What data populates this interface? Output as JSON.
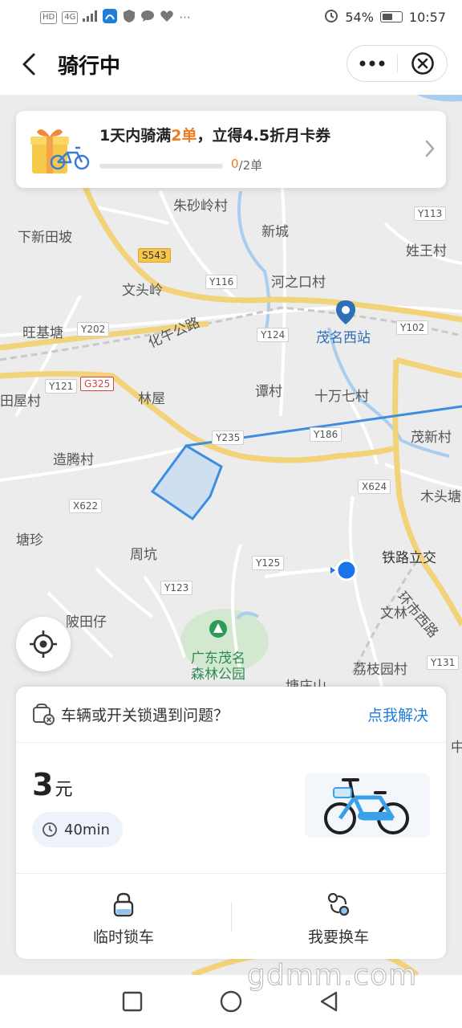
{
  "status_bar": {
    "chips": [
      "HD",
      "4G"
    ],
    "battery_percent": "54%",
    "battery_level": 0.54,
    "time": "10:57",
    "icons": [
      "signal-icon",
      "app-icon",
      "shield-icon",
      "chat-icon",
      "heart-icon",
      "more-icon",
      "alarm-icon",
      "battery-icon"
    ],
    "overflow": "···"
  },
  "header": {
    "title": "骑行中"
  },
  "promo": {
    "title_prefix": "1天内骑满",
    "title_highlight": "2单",
    "title_suffix": "，立得4.5折月卡券",
    "progress_current": "0",
    "progress_total": "/2单",
    "progress_fraction": 0
  },
  "map": {
    "labels": [
      "朱砂岭村",
      "新城",
      "下新田坡",
      "姓王村",
      "文头岭",
      "河之口村",
      "旺基塘",
      "化午公路",
      "茂名西站",
      "林屋",
      "谭村",
      "十万七村",
      "茂新村",
      "造腾村",
      "木头塘",
      "塘珍",
      "周坑",
      "铁路立交",
      "陂田仔",
      "文林",
      "环市西路",
      "广东茂名",
      "森林公园",
      "荔枝园村",
      "塘庄山",
      "田屋村",
      "中"
    ],
    "road_badges": [
      "Y113",
      "S543",
      "Y116",
      "Y202",
      "Y124",
      "Y102",
      "Y121",
      "G325",
      "Y235",
      "Y186",
      "X624",
      "X622",
      "Y125",
      "Y123",
      "Y131"
    ],
    "colors": {
      "route": "#3d8ee0",
      "area_fill": "#cfdff2",
      "highway": "#f2d37a",
      "water": "#9fc5ec",
      "park": "#cfe6cf"
    }
  },
  "card": {
    "issue_text": "车辆或开关锁遇到问题？",
    "issue_link": "点我解决",
    "fare_amount": "3",
    "fare_unit": "元",
    "duration": "40min",
    "actions": [
      {
        "label": "临时锁车",
        "icon": "lock-icon"
      },
      {
        "label": "我要换车",
        "icon": "swap-bike-icon"
      }
    ]
  },
  "watermark": "gdmm.com",
  "accent": "#f07a1f",
  "link_color": "#1f7fd8"
}
